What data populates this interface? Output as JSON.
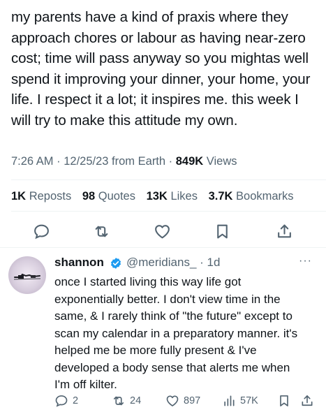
{
  "tweet": {
    "text": "my parents have a kind of praxis where they\napproach chores or labour as having near-zero\ncost; time will pass anyway so you mightas well\nspend it improving your dinner, your home, your\nlife. I respect it a lot; it inspires me. this week I\nwill try to make this attitude my own.",
    "time": "7:26 AM",
    "date": "12/25/23",
    "source": "from Earth",
    "views_count": "849K",
    "views_label": "Views"
  },
  "stats": {
    "reposts_count": "1K",
    "reposts_label": "Reposts",
    "quotes_count": "98",
    "quotes_label": "Quotes",
    "likes_count": "13K",
    "likes_label": "Likes",
    "bookmarks_count": "3.7K",
    "bookmarks_label": "Bookmarks"
  },
  "actions": [
    "reply-icon",
    "repost-icon",
    "like-icon",
    "bookmark-icon",
    "share-icon"
  ],
  "reply": {
    "name": "shannon",
    "handle": "@meridians_",
    "age": "1d",
    "text": "once I started living this way life got\nexponentially better. I don't view time in the\nsame, & I rarely think of \"the future\" except to\nscan my calendar in a preparatory manner. it's\nhelped me be more fully present & I've\ndeveloped a body sense that alerts me when\nI'm off kilter.",
    "replies": "2",
    "reposts": "24",
    "likes": "897",
    "views": "57K"
  },
  "colors": {
    "text": "#0f1419",
    "muted": "#536471",
    "verified": "#1d9bf0",
    "divider": "#eff3f4"
  }
}
